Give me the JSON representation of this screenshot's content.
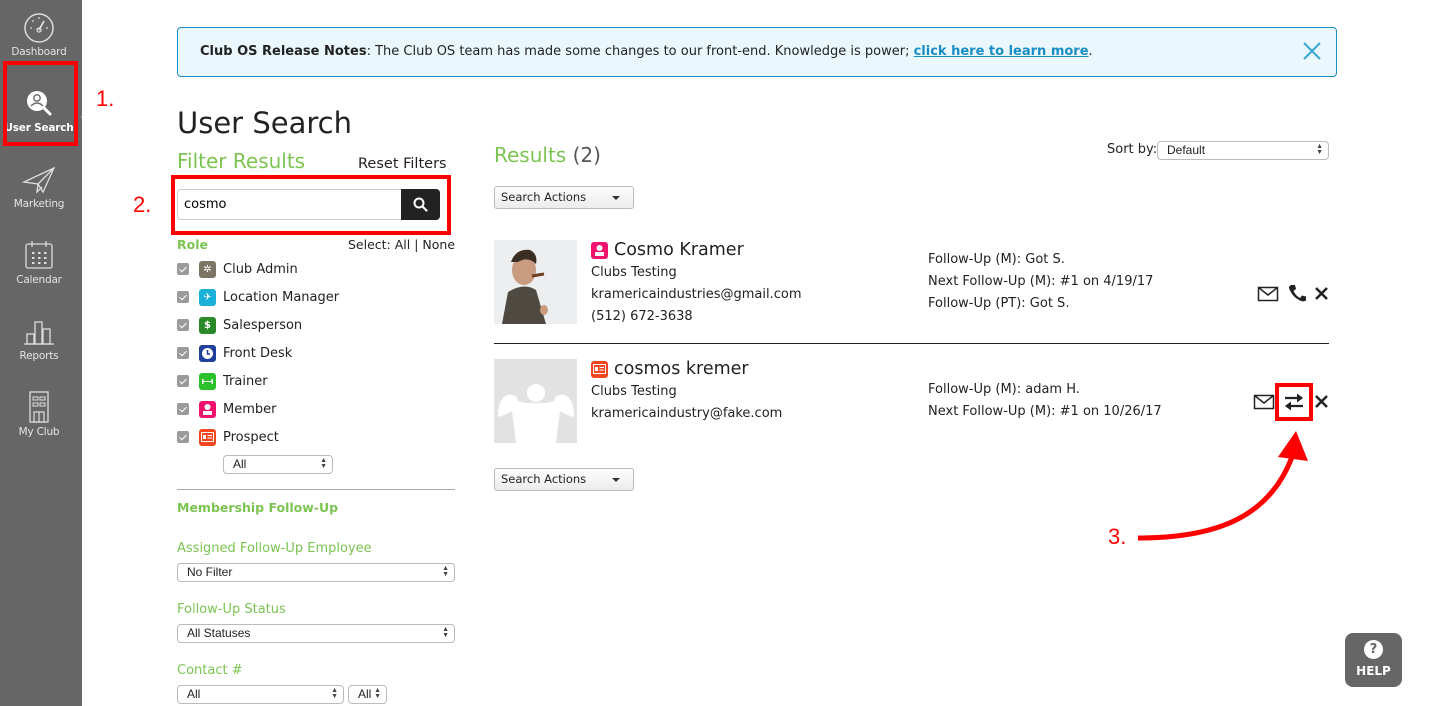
{
  "sidebar": {
    "items": [
      {
        "label": "Dashboard",
        "icon": "gauge-icon",
        "active": false
      },
      {
        "label": "User Search",
        "icon": "user-search-icon",
        "active": true
      },
      {
        "label": "Marketing",
        "icon": "paper-plane-icon",
        "active": false
      },
      {
        "label": "Calendar",
        "icon": "calendar-icon",
        "active": false
      },
      {
        "label": "Reports",
        "icon": "bar-chart-icon",
        "active": false
      },
      {
        "label": "My Club",
        "icon": "building-icon",
        "active": false
      }
    ]
  },
  "annotations": {
    "step1": "1.",
    "step2": "2.",
    "step3": "3.",
    "color": "#ff0000"
  },
  "banner": {
    "bold": "Club OS Release Notes",
    "text": ": The Club OS team has made some changes to our front-end. Knowledge is power; ",
    "link": "click here to learn more",
    "end": "."
  },
  "page": {
    "title": "User Search"
  },
  "filters": {
    "title": "Filter Results",
    "reset": "Reset Filters",
    "search_value": "cosmo",
    "role_label": "Role",
    "select_prefix": "Select: ",
    "select_all": "All",
    "select_sep": " | ",
    "select_none": "None",
    "roles": [
      {
        "name": "Club Admin",
        "checked": true,
        "icon": "gear-icon",
        "color": "#7a7564"
      },
      {
        "name": "Location Manager",
        "checked": true,
        "icon": "pin-icon",
        "color": "#1ab0d8"
      },
      {
        "name": "Salesperson",
        "checked": true,
        "icon": "dollar-icon",
        "color": "#2a8a2a"
      },
      {
        "name": "Front Desk",
        "checked": true,
        "icon": "clock-icon",
        "color": "#1f3f9a"
      },
      {
        "name": "Trainer",
        "checked": true,
        "icon": "dumbbell-icon",
        "color": "#2bc12b"
      },
      {
        "name": "Member",
        "checked": true,
        "icon": "person-icon",
        "color": "#f0136d"
      },
      {
        "name": "Prospect",
        "checked": true,
        "icon": "id-card-icon",
        "color": "#f4461f"
      }
    ],
    "role_select": "All",
    "section_title": "Membership Follow-Up",
    "assigned_label": "Assigned Follow-Up Employee",
    "assigned_value": "No Filter",
    "status_label": "Follow-Up Status",
    "status_value": "All Statuses",
    "contact_label": "Contact #",
    "contact_value": "All",
    "contact_value2": "All"
  },
  "results": {
    "title": "Results",
    "count": "(2)",
    "sort_label": "Sort by:",
    "sort_value": "Default",
    "actions_label": "Search Actions",
    "users": [
      {
        "name": "Cosmo Kramer",
        "role_icon": "member-icon",
        "club": "Clubs Testing",
        "email": "kramericaindustries@gmail.com",
        "phone": "(512) 672-3638",
        "followups": [
          "Follow-Up (M): Got S.",
          "Next Follow-Up (M): #1 on 4/19/17",
          "Follow-Up (PT): Got S."
        ],
        "actions": [
          "email",
          "phone",
          "remove"
        ]
      },
      {
        "name": "cosmos kremer",
        "role_icon": "prospect-icon",
        "club": "Clubs Testing",
        "email": "kramericaindustry@fake.com",
        "phone": "",
        "followups": [
          "Follow-Up (M): adam H.",
          "Next Follow-Up (M): #1 on 10/26/17"
        ],
        "actions": [
          "email",
          "convert",
          "remove"
        ]
      }
    ]
  },
  "help": {
    "label": "HELP",
    "glyph": "?"
  }
}
